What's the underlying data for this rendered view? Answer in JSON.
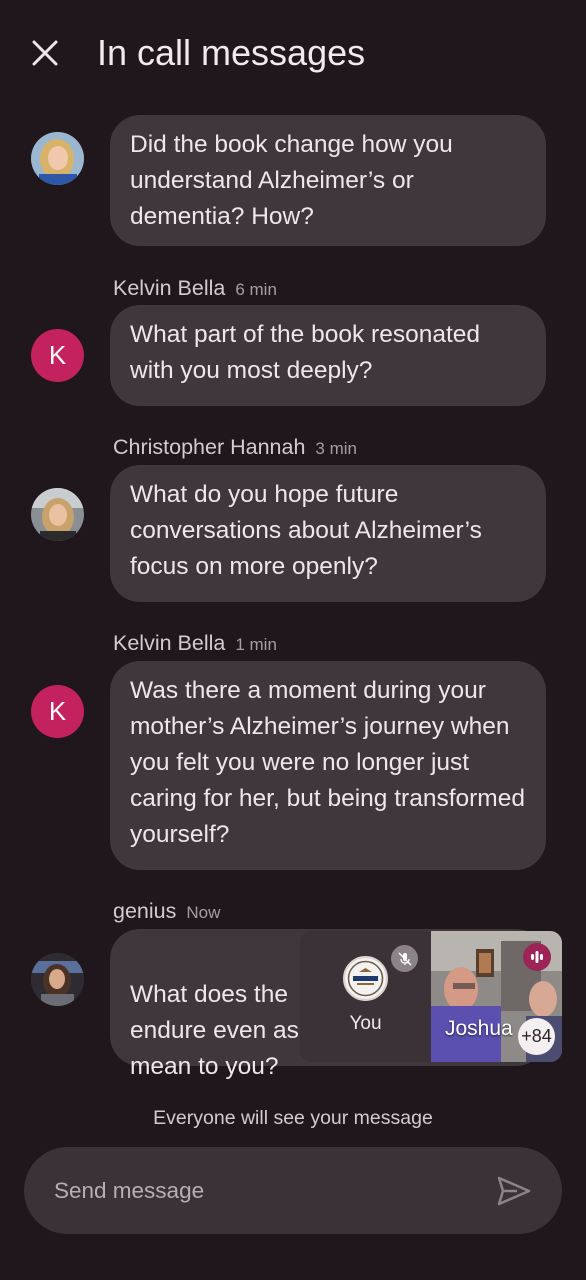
{
  "header": {
    "title": "In call messages",
    "close_icon": "close-icon"
  },
  "messages": [
    {
      "sender": "",
      "time": "",
      "avatar": "photo",
      "text": "Did the book change how you understand Alzheimer’s or dementia? How?"
    },
    {
      "sender": "Kelvin Bella",
      "time": "6 min",
      "avatar": "K",
      "text": "What part of the book resonated with you most deeply?"
    },
    {
      "sender": "Christopher Hannah",
      "time": "3 min",
      "avatar": "photo",
      "text": "What do you hope future conversations about Alzheimer’s focus on more openly?"
    },
    {
      "sender": "Kelvin Bella",
      "time": "1 min",
      "avatar": "K",
      "text": "Was there a moment during your mother’s Alzheimer’s journey when you felt you were no longer just caring for her, but being transformed yourself?"
    },
    {
      "sender": "genius",
      "time": "Now",
      "avatar": "photo",
      "text": "What does the\nendure even as\nmean to you?"
    }
  ],
  "pip": {
    "self_label": "You",
    "participant_name": "Joshua",
    "more_count": "+84",
    "mic_icon": "mic-off-icon",
    "speaking_icon": "speaking-indicator-icon"
  },
  "notice": "Everyone will see your message",
  "composer": {
    "placeholder": "Send message",
    "send_icon": "send-icon"
  },
  "colors": {
    "background": "#1f171b",
    "bubble": "#3f373b",
    "avatar_k": "#c4215f"
  }
}
